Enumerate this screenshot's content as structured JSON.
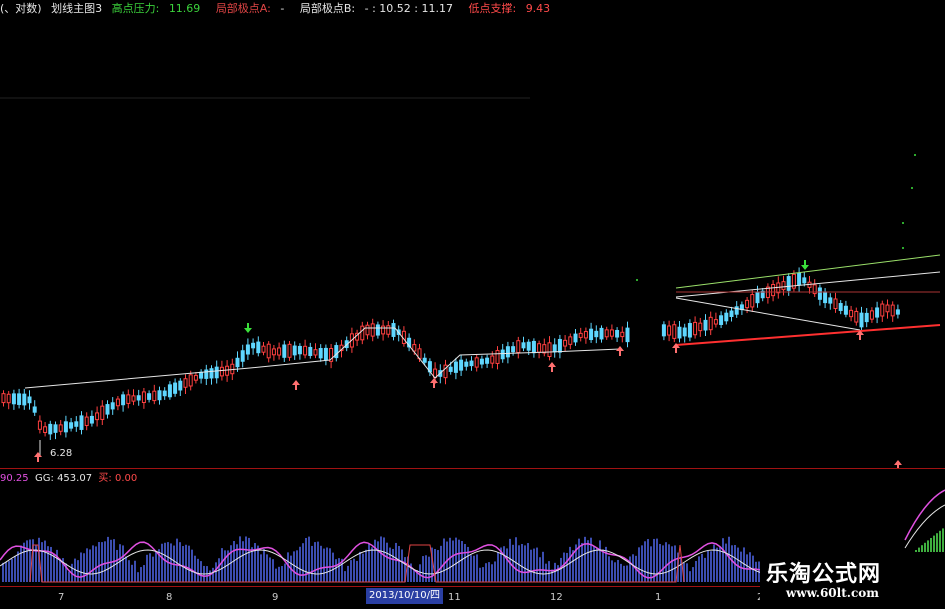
{
  "topbar": {
    "mode_text": "(、对数)",
    "indicator_name": "划线主图3",
    "high_pressure_label": "高点压力:",
    "high_pressure_value": "11.69",
    "local_a_label": "局部极点A:",
    "local_a_value": "-",
    "local_b_label": "局部极点B:",
    "local_b_value": "- : 10.52 : 11.17",
    "low_support_label": "低点支撑:",
    "low_support_value": "9.43"
  },
  "main_chart": {
    "low_label": "6.28",
    "colors": {
      "up": "#ff4040",
      "down": "#5fd7ff",
      "support": "#ff3030",
      "pressure": "#9be06a",
      "trend": "#e6e6e6"
    }
  },
  "sub_indicator": {
    "left_value": "90.25",
    "gg_label": "GG:",
    "gg_value": "453.07",
    "buy_label": "买:",
    "buy_value": "0.00"
  },
  "x_axis": {
    "ticks": [
      "7",
      "8",
      "9",
      "11",
      "12",
      "1",
      "2"
    ],
    "cursor_date": "2013/10/10/四"
  },
  "watermark": {
    "name": "乐淘公式网",
    "url": "www.60lt.com"
  }
}
